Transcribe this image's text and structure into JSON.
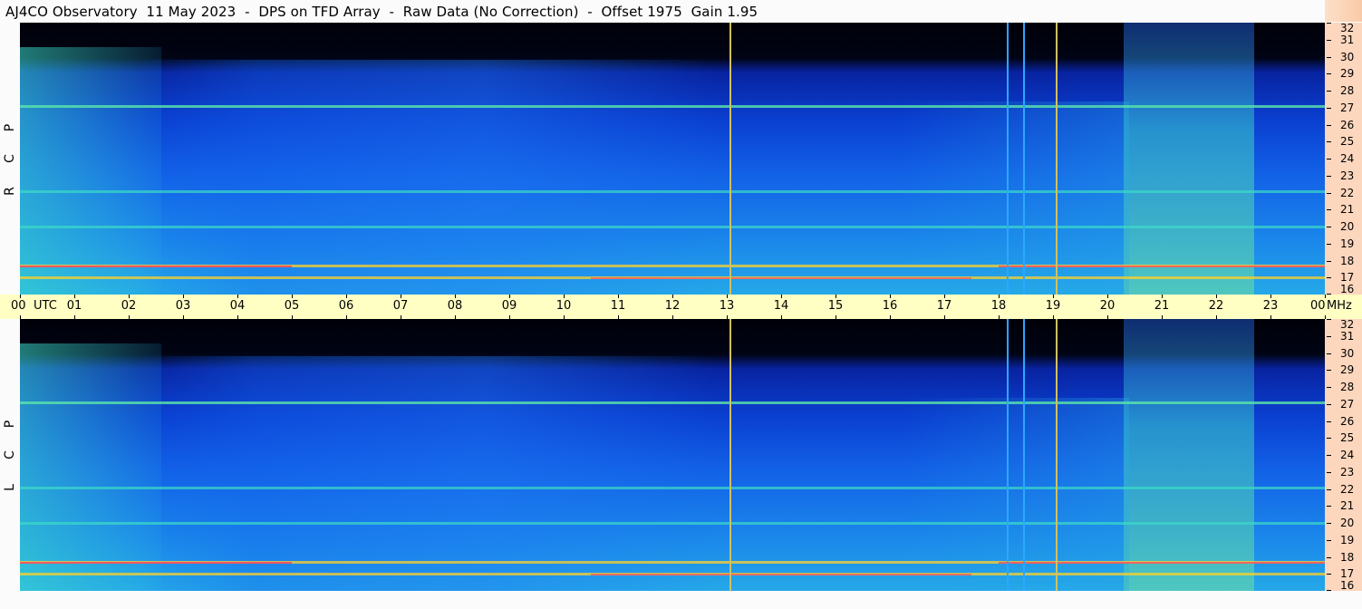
{
  "header": {
    "title": "AJ4CO Observatory  11 May 2023  -  DPS on TFD Array  -  Raw Data (No Correction)  -  Offset 1975  Gain 1.95"
  },
  "panels": [
    {
      "id": "rcp",
      "polarization_label": [
        "R",
        "C",
        "P"
      ]
    },
    {
      "id": "lcp",
      "polarization_label": [
        "L",
        "C",
        "P"
      ]
    }
  ],
  "time_axis": {
    "labels": [
      "00",
      "UTC",
      "01",
      "02",
      "03",
      "04",
      "05",
      "06",
      "07",
      "08",
      "09",
      "10",
      "11",
      "12",
      "13",
      "14",
      "15",
      "16",
      "17",
      "18",
      "19",
      "20",
      "21",
      "22",
      "23",
      "00",
      "MHz"
    ]
  },
  "freq_axis": {
    "labels": [
      "32",
      "31",
      "30",
      "29",
      "28",
      "27",
      "26",
      "25",
      "24",
      "23",
      "22",
      "21",
      "20",
      "19",
      "18",
      "17",
      "16"
    ]
  },
  "colors": {
    "background_low": "#000010",
    "background_mid": "#0a3cc8",
    "noise_high": "#22e0c8",
    "interference": "#ffd028",
    "strong": "#ff3060",
    "time_axis_bg": "#ffffc4",
    "freq_axis_bg": "#fcd6bd"
  },
  "chart_data": [
    {
      "type": "heatmap",
      "title": "AJ4CO Observatory 11 May 2023 - DPS on TFD Array - Raw Data (No Correction) - Offset 1975 Gain 1.95",
      "polarization": "RCP",
      "xlabel": "UTC",
      "ylabel": "MHz",
      "x": [
        "00",
        "01",
        "02",
        "03",
        "04",
        "05",
        "06",
        "07",
        "08",
        "09",
        "10",
        "11",
        "12",
        "13",
        "14",
        "15",
        "16",
        "17",
        "18",
        "19",
        "20",
        "21",
        "22",
        "23",
        "00"
      ],
      "y": [
        16,
        17,
        18,
        19,
        20,
        21,
        22,
        23,
        24,
        25,
        26,
        27,
        28,
        29,
        30,
        31,
        32
      ],
      "ylim": [
        16,
        32
      ],
      "grid": false,
      "legend": "none",
      "features": {
        "vertical_interference_utc": [
          13.05,
          18.15,
          18.45,
          19.05
        ],
        "horizontal_carriers_mhz": [
          27.1,
          22.1,
          20.0,
          17.7,
          17.0
        ],
        "ionospheric_cutoff_mhz": 29.5
      }
    },
    {
      "type": "heatmap",
      "polarization": "LCP",
      "xlabel": "UTC",
      "ylabel": "MHz",
      "x": [
        "00",
        "01",
        "02",
        "03",
        "04",
        "05",
        "06",
        "07",
        "08",
        "09",
        "10",
        "11",
        "12",
        "13",
        "14",
        "15",
        "16",
        "17",
        "18",
        "19",
        "20",
        "21",
        "22",
        "23",
        "00"
      ],
      "y": [
        16,
        17,
        18,
        19,
        20,
        21,
        22,
        23,
        24,
        25,
        26,
        27,
        28,
        29,
        30,
        31,
        32
      ],
      "ylim": [
        16,
        32
      ],
      "grid": false,
      "legend": "none",
      "features": {
        "vertical_interference_utc": [
          13.05,
          18.15,
          18.45,
          19.05
        ],
        "horizontal_carriers_mhz": [
          27.1,
          22.1,
          20.0,
          17.7,
          17.0
        ],
        "ionospheric_cutoff_mhz": 29.5
      }
    }
  ]
}
